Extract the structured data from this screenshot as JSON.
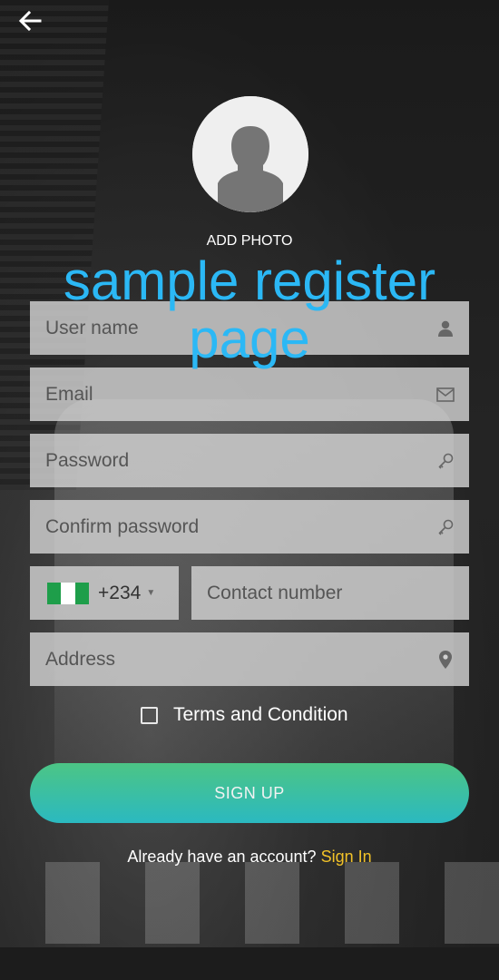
{
  "header": {
    "back_icon": "arrow-left-icon"
  },
  "avatar": {
    "icon": "user-silhouette-icon",
    "add_photo_label": "ADD PHOTO"
  },
  "watermark": "sample register page",
  "form": {
    "username_placeholder": "User name",
    "email_placeholder": "Email",
    "password_placeholder": "Password",
    "confirm_password_placeholder": "Confirm password",
    "country_code": "+234",
    "country_flag": "nigeria-flag-icon",
    "contact_placeholder": "Contact number",
    "address_placeholder": "Address",
    "terms_label": "Terms and Condition",
    "terms_checked": false
  },
  "actions": {
    "signup_label": "SIGN UP",
    "already_text": "Already have an account?",
    "signin_label": "Sign In"
  },
  "colors": {
    "accent_start": "#4cc585",
    "accent_end": "#2bb9c0",
    "signin_link": "#f2c228",
    "watermark": "#2bb8f5"
  }
}
